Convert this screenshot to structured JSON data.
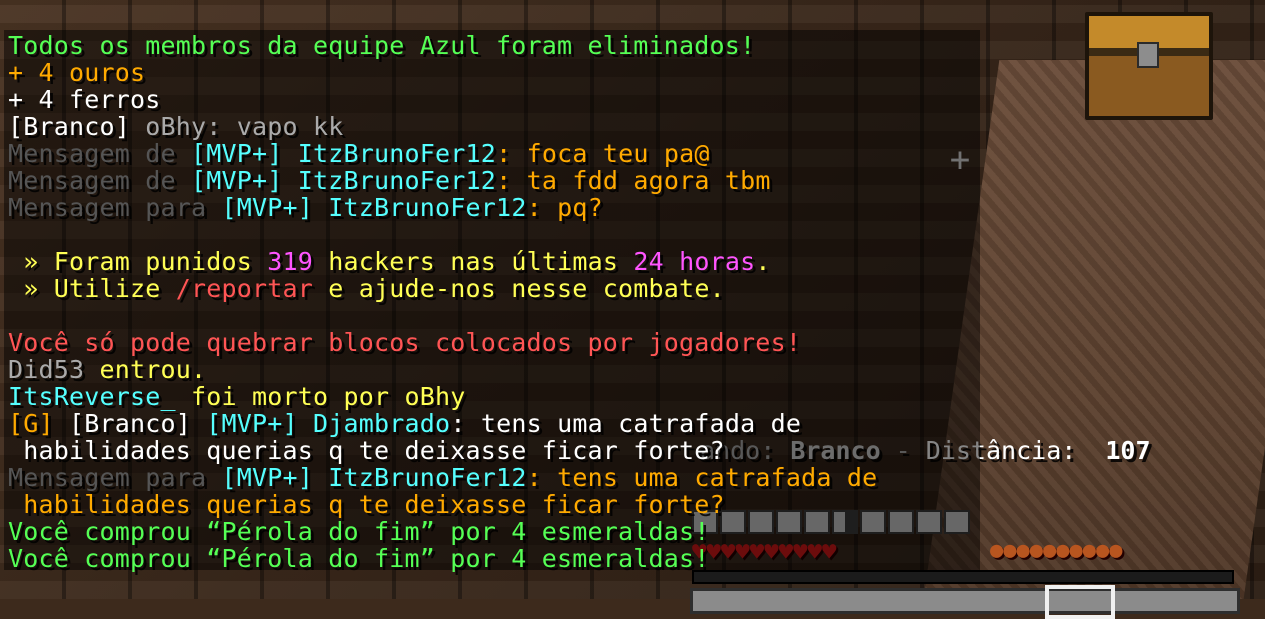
{
  "chat": {
    "l1": "Todos os membros da equipe Azul foram eliminados!",
    "l2": "+ 4 ouros",
    "l3": "+ 4 ferros",
    "l4_team": "[Branco]",
    "l4_name": " oBhy",
    "l4_msg": ": vapo kk",
    "pm1_prefix": "Mensagem de ",
    "pm1_rank": "[MVP+]",
    "pm1_name": " ItzBrunoFer12",
    "pm1_msg": ": foca teu pa@",
    "pm2_prefix": "Mensagem de ",
    "pm2_rank": "[MVP+]",
    "pm2_name": " ItzBrunoFer12",
    "pm2_msg": ": ta fdd agora tbm",
    "pm3_prefix": "Mensagem para ",
    "pm3_rank": "[MVP+]",
    "pm3_name": " ItzBrunoFer12",
    "pm3_msg": ": pq?",
    "ann1_a": " » Foram punidos ",
    "ann1_n1": "319",
    "ann1_b": " hackers nas últimas ",
    "ann1_n2": "24 horas",
    "ann1_c": ".",
    "ann2_a": " » Utilize ",
    "ann2_cmd": "/reportar",
    "ann2_b": " e ajude-nos nesse combate.",
    "warn": "Você só pode quebrar blocos colocados por jogadores!",
    "join_name": "Did53",
    "join_msg": " entrou.",
    "kill_victim": "ItsReverse_",
    "kill_msg": " foi morto por oBhy",
    "g_tag": "[G]",
    "g_team": " [Branco]",
    "g_rank": " [MVP+]",
    "g_name": " Djambrado",
    "g_msg": ": tens uma catrafada de",
    "g_msg2": " habilidades querias q te deixasse ficar forte?",
    "pm4_prefix": "Mensagem para ",
    "pm4_rank": "[MVP+]",
    "pm4_name": " ItzBrunoFer12",
    "pm4_msg": ": tens uma catrafada de",
    "pm4_msg2": " habilidades querias q te deixasse ficar forte?",
    "buy1": "Você comprou “Pérola do fim” por 4 esmeraldas!",
    "buy2": "Você comprou “Pérola do fim” por 4 esmeraldas!"
  },
  "hud": {
    "tracking_label": "ando: ",
    "tracking_team": "Branco",
    "tracking_sep": " - ",
    "distance_label": "Distância: ",
    "distance_value": "107",
    "hearts": "♥♥♥♥♥♥♥♥♥♥",
    "food": "●●●●●●●●●●"
  },
  "colors": {
    "green": "#55ff55",
    "gold": "#ffaa00",
    "aqua": "#55ffff",
    "gray": "#aaaaaa",
    "dark_gray": "#555555",
    "red": "#ff5555",
    "pink": "#ff55ff",
    "yellow": "#ffff55"
  }
}
